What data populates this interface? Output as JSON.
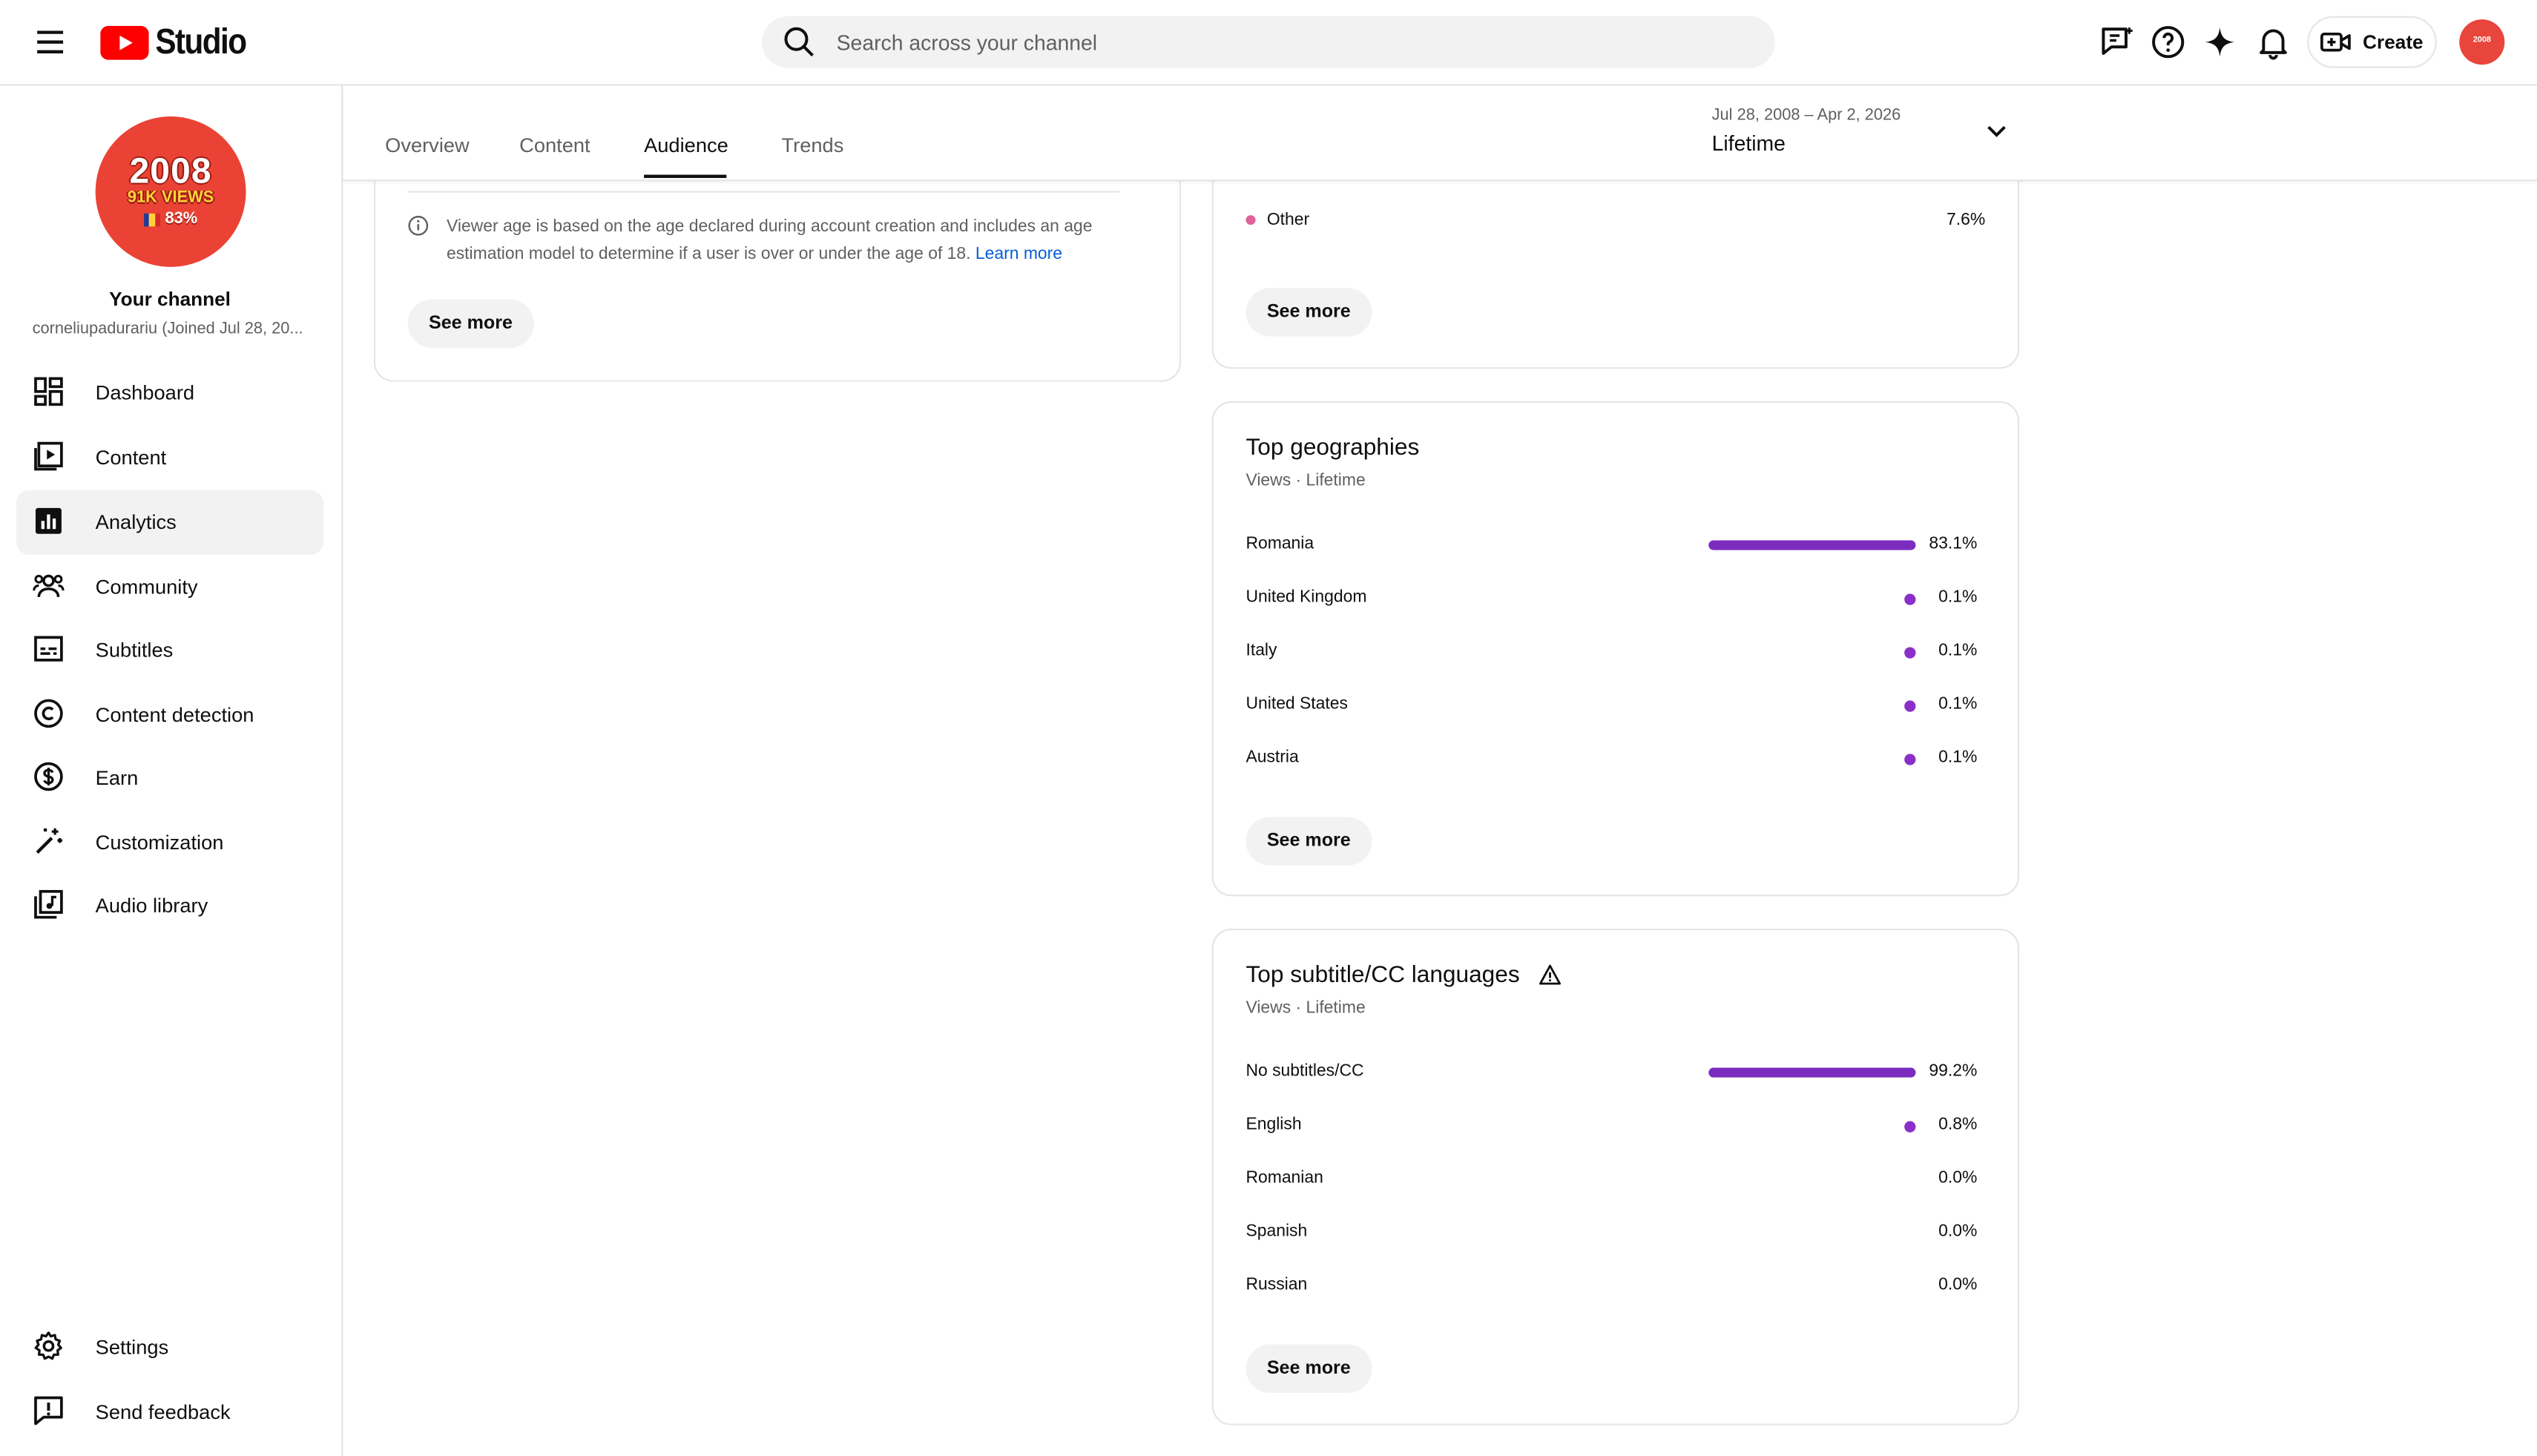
{
  "app": {
    "brand": "Studio",
    "search_placeholder": "Search across your channel",
    "create_label": "Create",
    "avatar_small_text": "2008"
  },
  "channel": {
    "avatar_year": "2008",
    "avatar_views": "91K VIEWS",
    "avatar_pct": "83%",
    "name": "Your channel",
    "handle": "corneliupadurariu (Joined Jul 28, 20..."
  },
  "sidebar": {
    "items": [
      {
        "label": "Dashboard",
        "icon": "dashboard-icon"
      },
      {
        "label": "Content",
        "icon": "content-icon"
      },
      {
        "label": "Analytics",
        "icon": "analytics-icon",
        "active": true
      },
      {
        "label": "Community",
        "icon": "community-icon"
      },
      {
        "label": "Subtitles",
        "icon": "subtitles-icon"
      },
      {
        "label": "Content detection",
        "icon": "copyright-icon"
      },
      {
        "label": "Earn",
        "icon": "dollar-icon"
      },
      {
        "label": "Customization",
        "icon": "magic-wand-icon"
      },
      {
        "label": "Audio library",
        "icon": "audio-library-icon"
      }
    ],
    "bottom": [
      {
        "label": "Settings",
        "icon": "gear-icon"
      },
      {
        "label": "Send feedback",
        "icon": "feedback-icon"
      }
    ]
  },
  "tabs": [
    {
      "label": "Overview"
    },
    {
      "label": "Content"
    },
    {
      "label": "Audience",
      "active": true
    },
    {
      "label": "Trends"
    }
  ],
  "date": {
    "range": "Jul 28, 2008 – Apr 2, 2026",
    "period": "Lifetime"
  },
  "age_card": {
    "info": "Viewer age is based on the age declared during account creation and includes an age estimation model to determine if a user is over or under the age of 18.",
    "learn_more": "Learn more",
    "see_more": "See more"
  },
  "top_partial_card": {
    "other_label": "Other",
    "other_value": "7.6%",
    "see_more": "See more"
  },
  "geographies": {
    "title": "Top geographies",
    "subtitle": "Views · Lifetime",
    "see_more": "See more",
    "rows": [
      {
        "label": "Romania",
        "value": "83.1%",
        "fraction": 0.831
      },
      {
        "label": "United Kingdom",
        "value": "0.1%",
        "fraction": 0.001
      },
      {
        "label": "Italy",
        "value": "0.1%",
        "fraction": 0.001
      },
      {
        "label": "United States",
        "value": "0.1%",
        "fraction": 0.001
      },
      {
        "label": "Austria",
        "value": "0.1%",
        "fraction": 0.001
      }
    ]
  },
  "subtitles": {
    "title": "Top subtitle/CC languages",
    "subtitle": "Views · Lifetime",
    "see_more": "See more",
    "rows": [
      {
        "label": "No subtitles/CC",
        "value": "99.2%",
        "fraction": 0.992
      },
      {
        "label": "English",
        "value": "0.8%",
        "fraction": 0.008
      },
      {
        "label": "Romanian",
        "value": "0.0%",
        "fraction": 0
      },
      {
        "label": "Spanish",
        "value": "0.0%",
        "fraction": 0
      },
      {
        "label": "Russian",
        "value": "0.0%",
        "fraction": 0
      }
    ]
  },
  "colors": {
    "brand_red": "#ff0000",
    "bar_purple": "#7b2cbf",
    "other_pink": "#e0609a",
    "link_blue": "#065fd4"
  }
}
